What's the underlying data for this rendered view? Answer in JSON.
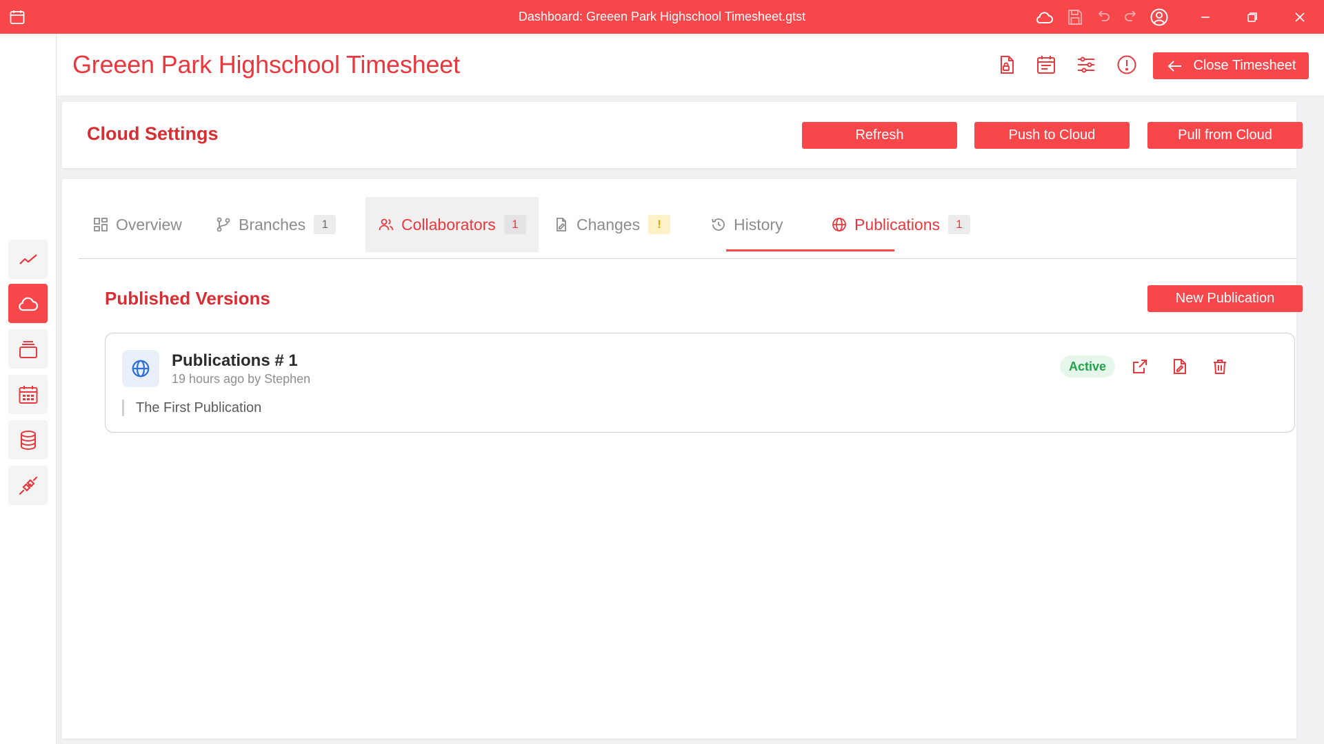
{
  "window": {
    "title": "Dashboard: Greeen Park Highschool Timesheet.gtst"
  },
  "header": {
    "title": "Greeen Park Highschool Timesheet",
    "close_label": "Close Timesheet"
  },
  "cloud_settings": {
    "title": "Cloud Settings",
    "refresh_label": "Refresh",
    "push_label": "Push to Cloud",
    "pull_label": "Pull from Cloud"
  },
  "tabs": [
    {
      "label": "Overview",
      "badge": null
    },
    {
      "label": "Branches",
      "badge": "1"
    },
    {
      "label": "Collaborators",
      "badge": "1"
    },
    {
      "label": "Changes",
      "badge": "!"
    },
    {
      "label": "History",
      "badge": null
    },
    {
      "label": "Publications",
      "badge": "1"
    }
  ],
  "publications": {
    "title": "Published Versions",
    "new_label": "New Publication",
    "items": [
      {
        "name": "Publications # 1",
        "meta": "19 hours ago by Stephen",
        "description": "The First Publication",
        "status": "Active"
      }
    ]
  },
  "colors": {
    "accent": "#f8474b",
    "title_red": "#d82d32",
    "status_green": "#22a04b",
    "warn_yellow": "#e0a800"
  },
  "icons": {
    "rail": [
      "trend-chart-icon",
      "cloud-icon",
      "stacked-layers-icon",
      "calendar-grid-icon",
      "database-icon",
      "plug-connect-icon"
    ]
  }
}
